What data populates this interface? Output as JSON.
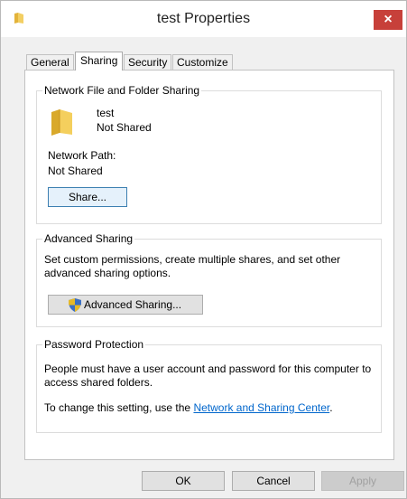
{
  "window": {
    "title": "test Properties",
    "close_glyph": "×"
  },
  "tabs": [
    {
      "label": "General"
    },
    {
      "label": "Sharing"
    },
    {
      "label": "Security"
    },
    {
      "label": "Customize"
    }
  ],
  "active_tab": "Sharing",
  "network_sharing": {
    "legend": "Network File and Folder Sharing",
    "folder_name": "test",
    "share_status": "Not Shared",
    "network_path_label": "Network Path:",
    "network_path_value": "Not Shared",
    "share_button": "Share..."
  },
  "advanced_sharing": {
    "legend": "Advanced Sharing",
    "description": "Set custom permissions, create multiple shares, and set other advanced sharing options.",
    "button": "Advanced Sharing..."
  },
  "password_protection": {
    "legend": "Password Protection",
    "description": "People must have a user account and password for this computer to access shared folders.",
    "change_prefix": "To change this setting, use the ",
    "link": "Network and Sharing Center",
    "change_suffix": "."
  },
  "buttons": {
    "ok": "OK",
    "cancel": "Cancel",
    "apply": "Apply"
  }
}
